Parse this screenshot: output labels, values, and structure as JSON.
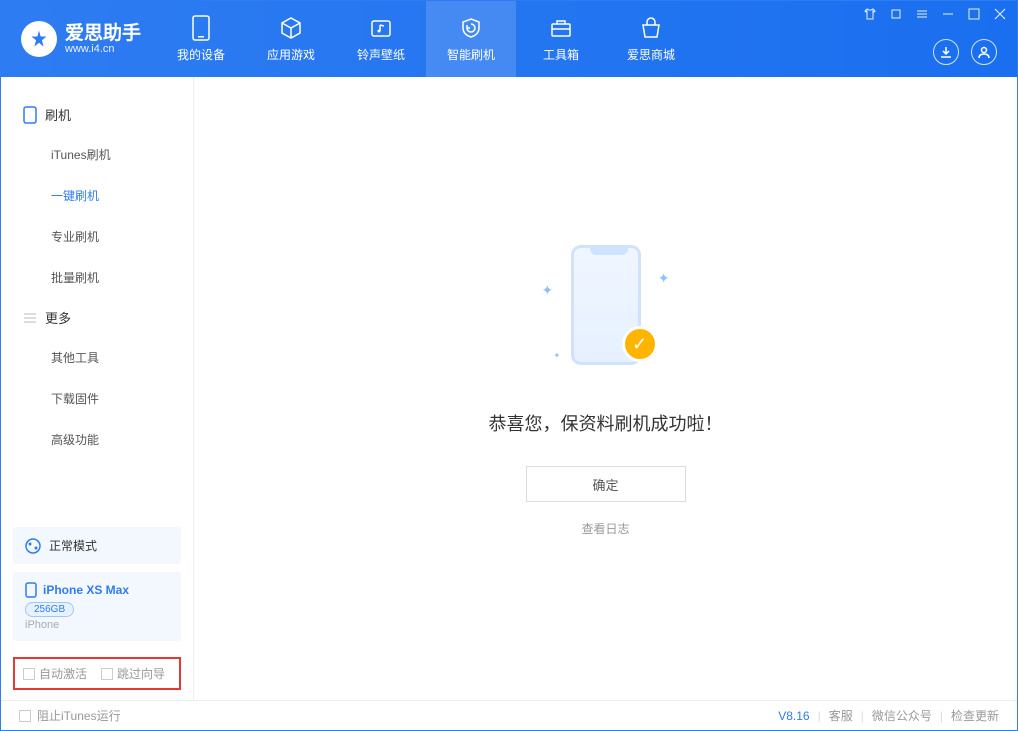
{
  "app": {
    "name": "爱思助手",
    "url": "www.i4.cn"
  },
  "nav": {
    "tabs": [
      {
        "label": "我的设备"
      },
      {
        "label": "应用游戏"
      },
      {
        "label": "铃声壁纸"
      },
      {
        "label": "智能刷机"
      },
      {
        "label": "工具箱"
      },
      {
        "label": "爱思商城"
      }
    ]
  },
  "sidebar": {
    "group1": {
      "title": "刷机",
      "items": [
        "iTunes刷机",
        "一键刷机",
        "专业刷机",
        "批量刷机"
      ]
    },
    "group2": {
      "title": "更多",
      "items": [
        "其他工具",
        "下载固件",
        "高级功能"
      ]
    }
  },
  "mode": {
    "label": "正常模式"
  },
  "device": {
    "name": "iPhone XS Max",
    "storage": "256GB",
    "type": "iPhone"
  },
  "options": {
    "auto_activate": "自动激活",
    "skip_guide": "跳过向导"
  },
  "main": {
    "success": "恭喜您，保资料刷机成功啦！",
    "ok": "确定",
    "view_log": "查看日志"
  },
  "footer": {
    "block_itunes": "阻止iTunes运行",
    "version": "V8.16",
    "service": "客服",
    "wechat": "微信公众号",
    "update": "检查更新"
  }
}
